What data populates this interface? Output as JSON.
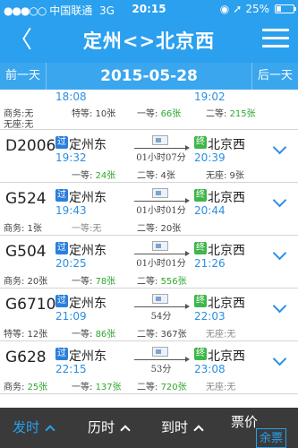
{
  "status": {
    "carrier": "中国联通",
    "network": "3G",
    "time": "20:15",
    "battery": "25%"
  },
  "nav": {
    "title": "定州<>北京西"
  },
  "datebar": {
    "prev": "前一天",
    "date": "2015-05-28",
    "next": "后一天"
  },
  "partial_row": {
    "dep_time": "18:08",
    "arr_time": "19:02",
    "seats": [
      "商务:无",
      "特等: 10张",
      "一等: 66张",
      "二等: 215张"
    ],
    "extra": "无座:无"
  },
  "trains": [
    {
      "no": "D2006",
      "dep": "定州东",
      "dep_time": "19:32",
      "arr": "北京西",
      "arr_time": "20:39",
      "duration": "01小时07分",
      "row1": [
        "",
        "一等: 24张",
        "二等: 4张",
        "无座: 9张"
      ],
      "row1_green": [
        false,
        true,
        false,
        false
      ]
    },
    {
      "no": "G524",
      "dep": "定州东",
      "dep_time": "19:43",
      "arr": "北京西",
      "arr_time": "20:44",
      "duration": "01小时01分",
      "row1": [
        "商务: 1张",
        "一等:无",
        "二等: 20张",
        ""
      ],
      "row1_green": [
        false,
        false,
        false,
        false
      ]
    },
    {
      "no": "G504",
      "dep": "定州东",
      "dep_time": "20:25",
      "arr": "北京西",
      "arr_time": "21:26",
      "duration": "01小时01分",
      "row1": [
        "商务: 20张",
        "一等: 78张",
        "二等: 556张",
        ""
      ],
      "row1_green": [
        false,
        true,
        true,
        false
      ]
    },
    {
      "no": "G6710",
      "dep": "定州东",
      "dep_time": "21:09",
      "arr": "北京西",
      "arr_time": "22:03",
      "duration": "54分",
      "row1": [
        "特等: 12张",
        "一等: 86张",
        "二等: 367张",
        "无座:无"
      ],
      "row1_green": [
        false,
        true,
        false,
        false
      ]
    },
    {
      "no": "G628",
      "dep": "定州东",
      "dep_time": "22:15",
      "arr": "北京西",
      "arr_time": "23:08",
      "duration": "53分",
      "row1": [
        "商务: 25张",
        "一等: 137张",
        "二等: 720张",
        "无座:无"
      ],
      "row1_green": [
        true,
        true,
        true,
        false
      ]
    }
  ],
  "badges": {
    "pass": "过",
    "term": "终"
  },
  "toolbar": {
    "depart": "发时",
    "duration": "历时",
    "arrive": "到时",
    "price": "票价",
    "remaining": "余票"
  }
}
